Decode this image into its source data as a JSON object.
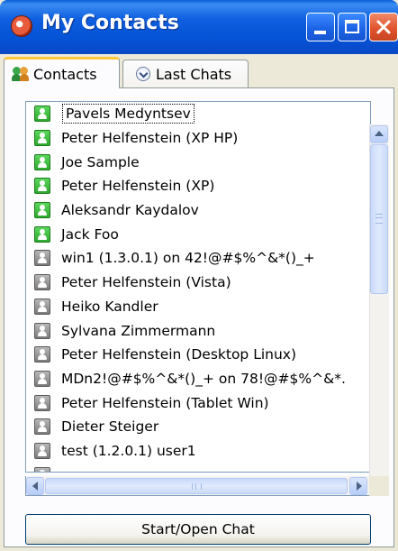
{
  "window": {
    "title": "My Contacts"
  },
  "tabs": [
    {
      "label": "Contacts",
      "active": true,
      "icon": "contacts-icon"
    },
    {
      "label": "Last Chats",
      "active": false,
      "icon": "chevron-down-circle-icon"
    }
  ],
  "contacts": [
    {
      "name": "Pavels Medyntsev",
      "status": "online",
      "selected": true
    },
    {
      "name": "Peter Helfenstein (XP HP)",
      "status": "online"
    },
    {
      "name": "Joe Sample",
      "status": "online"
    },
    {
      "name": "Peter Helfenstein (XP)",
      "status": "online"
    },
    {
      "name": "Aleksandr Kaydalov",
      "status": "online"
    },
    {
      "name": "Jack Foo",
      "status": "online"
    },
    {
      "name": "win1 (1.3.0.1) on 42!@#$%^&*()_+",
      "status": "offline"
    },
    {
      "name": "Peter Helfenstein (Vista)",
      "status": "offline"
    },
    {
      "name": "Heiko Kandler",
      "status": "offline"
    },
    {
      "name": "Sylvana Zimmermann",
      "status": "offline"
    },
    {
      "name": "Peter Helfenstein (Desktop Linux)",
      "status": "offline"
    },
    {
      "name": "MDn2!@#$%^&*()_+ on 78!@#$%^&*.",
      "status": "offline"
    },
    {
      "name": "Peter Helfenstein (Tablet Win)",
      "status": "offline"
    },
    {
      "name": "Dieter Steiger",
      "status": "offline"
    },
    {
      "name": "test (1.2.0.1) user1",
      "status": "offline"
    },
    {
      "name": "",
      "status": "offline"
    }
  ],
  "actions": {
    "start_chat_label": "Start/Open Chat"
  },
  "colors": {
    "titlebar": "#0553d6",
    "online": "#2fa82f",
    "offline": "#7a7a7a",
    "active_tab_accent": "#ffc83c"
  }
}
